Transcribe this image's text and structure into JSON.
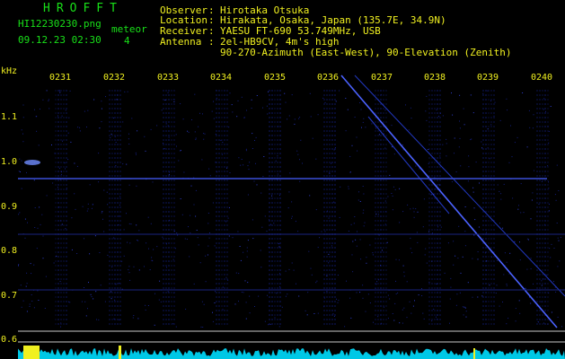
{
  "header": {
    "brand": "HROFFT",
    "filename": "HI12230230.png",
    "datetime": "09.12.23 02:30",
    "meteor_label": "meteor",
    "meteor_count": "4",
    "observer_key": "Observer",
    "observer_value": "Hirotaka Otsuka",
    "location_key": "Location",
    "location_value": "Hirakata, Osaka, Japan (135.7E, 34.9N)",
    "receiver_key": "Receiver",
    "receiver_value": "YAESU FT-690 53.749MHz, USB",
    "antenna_key": "Antenna",
    "antenna_value": "2el-HB9CV, 4m's high",
    "antenna_value2": "90-270-Azimuth (East-West), 90-Elevation (Zenith)"
  },
  "axis": {
    "unit": "kHz",
    "time_ticks": [
      "0231",
      "0232",
      "0233",
      "0234",
      "0235",
      "0236",
      "0237",
      "0238",
      "0239",
      "0240"
    ],
    "freq_ticks": [
      "1.1",
      "1.0",
      "0.9",
      "0.8",
      "0.7",
      "0.6"
    ]
  },
  "colors": {
    "background": "#000000",
    "text": "#ffffff",
    "brand": "#19e019",
    "axis_labels": "#f0f020",
    "signal": "#3a50ff",
    "noise": "#00c8e6",
    "ping": "#f0f020"
  }
}
